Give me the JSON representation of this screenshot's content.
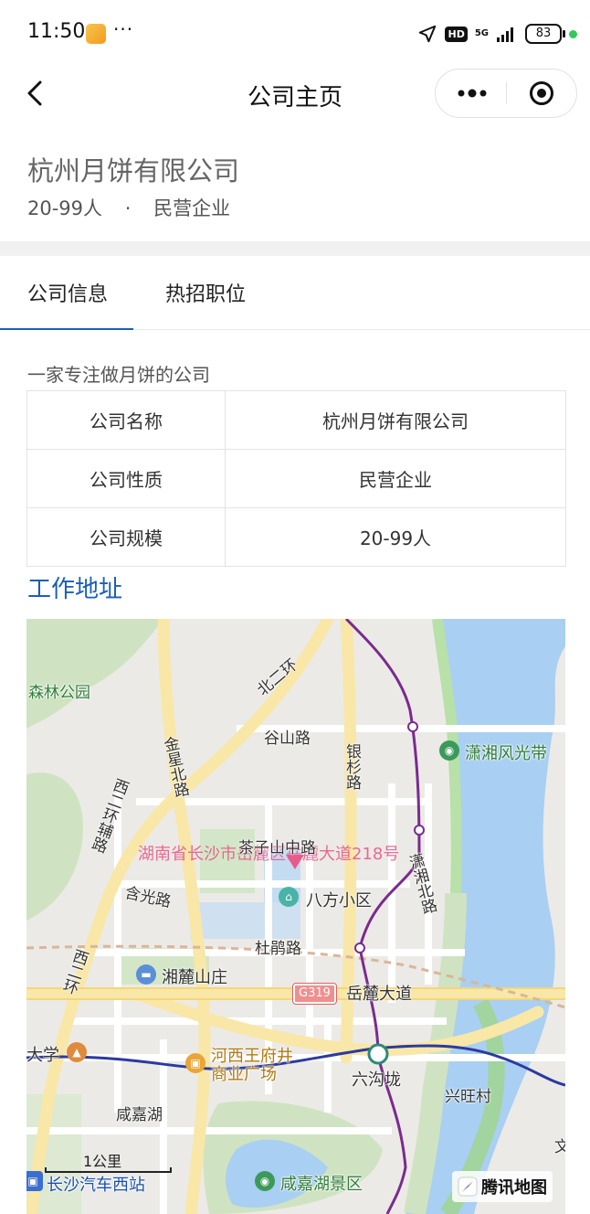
{
  "status": {
    "time": "11:50",
    "more": "···",
    "net": "5G",
    "battery": "83"
  },
  "nav": {
    "title": "公司主页"
  },
  "company": {
    "name": "杭州月饼有限公司",
    "size": "20-99人",
    "dot": "·",
    "type": "民营企业"
  },
  "tabs": [
    {
      "label": "公司信息",
      "active": true
    },
    {
      "label": "热招职位",
      "active": false
    }
  ],
  "info": {
    "description": "一家专注做月饼的公司",
    "rows": [
      {
        "key": "公司名称",
        "value": "杭州月饼有限公司"
      },
      {
        "key": "公司性质",
        "value": "民营企业"
      },
      {
        "key": "公司规模",
        "value": "20-99人"
      }
    ]
  },
  "address": {
    "title": "工作地址",
    "map": {
      "labels": {
        "forest_park": "森林公园",
        "beierhuan": "北二环",
        "gushan_road": "谷山路",
        "yinshan_road": "银杉路",
        "xiaoxiang_scenic": "潇湘风光带",
        "jinxing_road": "金星北路",
        "xierhuan_fu": "西二环辅路",
        "chazishan_road": "茶子山中路",
        "xiaoxiang_north": "潇湘北路",
        "hanguang_road": "含光路",
        "bafang": "八方小区",
        "dujuan_road": "杜鹃路",
        "xierhuan": "西二环",
        "xianglu_shanzhuang": "湘麓山庄",
        "g319": "G319",
        "yuelu_avenue": "岳麓大道",
        "university": "大学",
        "hexi_wangfujing_1": "河西王府井",
        "hexi_wangfujing_2": "商业广场",
        "liugoulong": "六沟垅",
        "xingwang": "兴旺村",
        "xianjiahu": "咸嘉湖",
        "wen": "文",
        "scale": "1公里",
        "west_bus": "长沙汽车西站",
        "xianjiahu_scenic": "咸嘉湖景区",
        "provider": "腾讯地图",
        "address_overlay": "湖南省长沙市岳麓区岳麓大道218号"
      }
    }
  },
  "colors": {
    "accent": "#1a5fb4",
    "river": "#a9cff2",
    "metro": "#7a2b8f"
  }
}
